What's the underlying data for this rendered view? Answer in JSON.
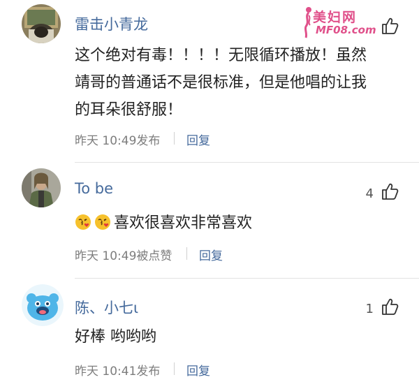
{
  "watermark": {
    "title": "美妇网",
    "url": "MF08.com"
  },
  "comments": [
    {
      "username": "雷击小青龙",
      "lines": [
        "这个绝对有毒！！！！无限循环播放！虽然",
        "靖哥的普通话不是很标准，但是他唱的让我",
        "的耳朵很舒服！"
      ],
      "time": "昨天 10:49发布",
      "reply_label": "回复",
      "likes": ""
    },
    {
      "username": "To be",
      "text": "喜欢很喜欢非常喜欢",
      "emojis": [
        "kiss-emoji",
        "kiss-emoji"
      ],
      "time": "昨天 10:49被点赞",
      "reply_label": "回复",
      "likes": "4"
    },
    {
      "username": "陈、小七ι",
      "text": "好棒 哟哟哟",
      "time": "昨天 10:41发布",
      "reply_label": "回复",
      "likes": "1"
    }
  ],
  "colors": {
    "username": "#456a9c",
    "text": "#222222",
    "meta": "#7d7d7d",
    "watermark": "#e0508a"
  }
}
